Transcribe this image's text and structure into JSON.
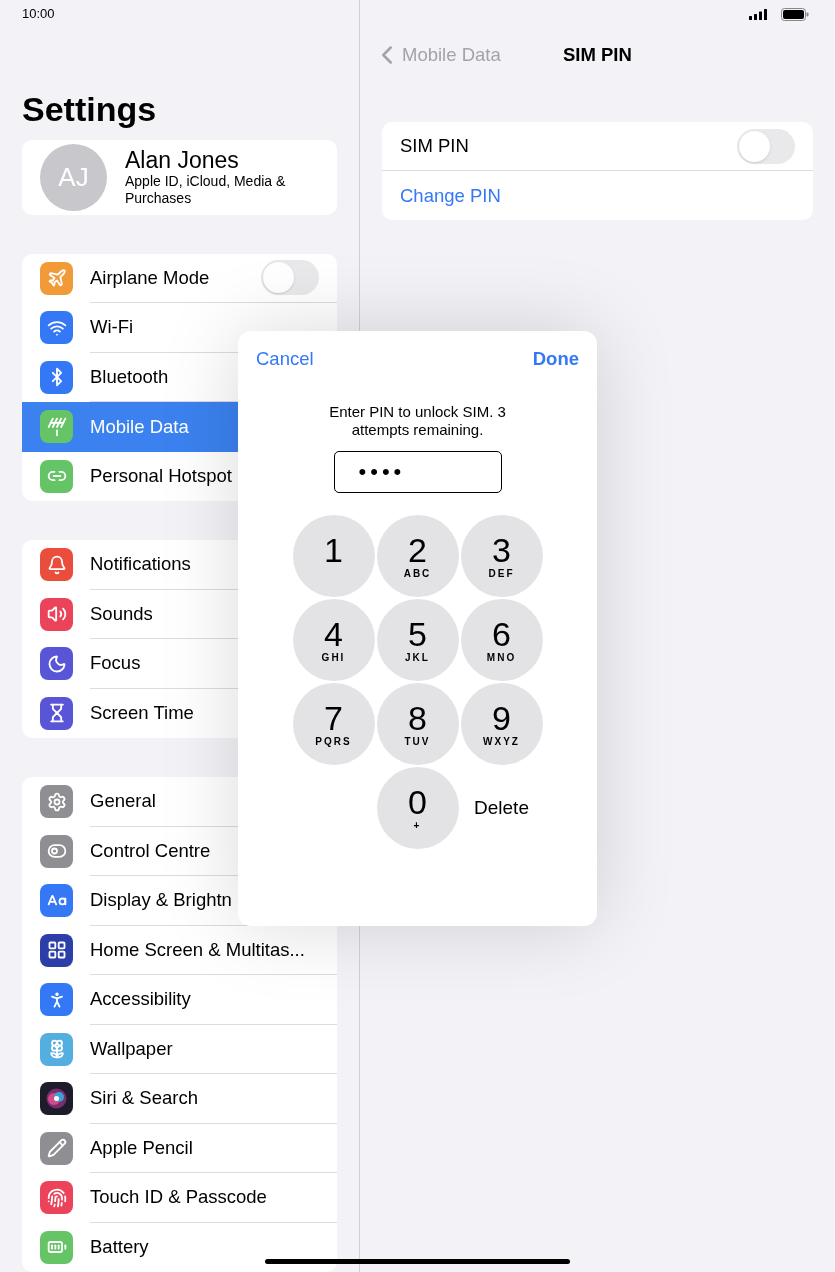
{
  "status_bar": {
    "time": "10:00"
  },
  "sidebar": {
    "title": "Settings",
    "profile": {
      "initials": "AJ",
      "name": "Alan Jones",
      "subtitle": "Apple ID, iCloud, Media & Purchases"
    },
    "groups": [
      [
        {
          "kind": "toggle",
          "color": "#f19a38",
          "label": "Airplane Mode",
          "on": false,
          "selected": false
        },
        {
          "kind": "link",
          "color": "#3478f6",
          "label": "Wi-Fi",
          "selected": false
        },
        {
          "kind": "link",
          "color": "#3478f6",
          "label": "Bluetooth",
          "selected": false
        },
        {
          "kind": "link",
          "color": "#65c466",
          "label": "Mobile Data",
          "selected": true
        },
        {
          "kind": "link",
          "color": "#65c466",
          "label": "Personal Hotspot",
          "selected": false
        }
      ],
      [
        {
          "kind": "link",
          "color": "#eb4d3d",
          "label": "Notifications",
          "selected": false
        },
        {
          "kind": "link",
          "color": "#eb445a",
          "label": "Sounds",
          "selected": false
        },
        {
          "kind": "link",
          "color": "#5856d6",
          "label": "Focus",
          "selected": false
        },
        {
          "kind": "link",
          "color": "#5856d6",
          "label": "Screen Time",
          "selected": false
        }
      ],
      [
        {
          "kind": "link",
          "color": "#8e8e93",
          "label": "General",
          "selected": false
        },
        {
          "kind": "link",
          "color": "#8e8e93",
          "label": "Control Centre",
          "selected": false
        },
        {
          "kind": "link",
          "color": "#3478f6",
          "label": "Display & Brightn",
          "selected": false
        },
        {
          "kind": "link",
          "color": "#2c3ea8",
          "label": "Home Screen & Multitas...",
          "selected": false
        },
        {
          "kind": "link",
          "color": "#3478f6",
          "label": "Accessibility",
          "selected": false
        },
        {
          "kind": "link",
          "color": "#55aee0",
          "label": "Wallpaper",
          "selected": false
        },
        {
          "kind": "link",
          "color": "#1c1c2a",
          "label": "Siri & Search",
          "selected": false
        },
        {
          "kind": "link",
          "color": "#8e8e93",
          "label": "Apple Pencil",
          "selected": false
        },
        {
          "kind": "link",
          "color": "#eb445a",
          "label": "Touch ID & Passcode",
          "selected": false
        },
        {
          "kind": "link",
          "color": "#65c466",
          "label": "Battery",
          "selected": false
        }
      ]
    ]
  },
  "detail": {
    "back": "Mobile Data",
    "title": "SIM PIN",
    "rows": [
      {
        "kind": "toggle",
        "label": "SIM PIN",
        "on": false
      },
      {
        "kind": "link",
        "label": "Change PIN"
      }
    ]
  },
  "dialog": {
    "cancel": "Cancel",
    "done": "Done",
    "message": "Enter PIN to unlock SIM. 3 attempts remaining.",
    "pin": "••••",
    "keys": [
      {
        "kind": "digit",
        "digit": "1"
      },
      {
        "kind": "digit",
        "digit": "2",
        "letters": "ABC"
      },
      {
        "kind": "digit",
        "digit": "3",
        "letters": "DEF"
      },
      {
        "kind": "digit",
        "digit": "4",
        "letters": "GHI"
      },
      {
        "kind": "digit",
        "digit": "5",
        "letters": "JKL"
      },
      {
        "kind": "digit",
        "digit": "6",
        "letters": "MNO"
      },
      {
        "kind": "digit",
        "digit": "7",
        "letters": "PQRS"
      },
      {
        "kind": "digit",
        "digit": "8",
        "letters": "TUV"
      },
      {
        "kind": "digit",
        "digit": "9",
        "letters": "WXYZ"
      },
      {
        "kind": "digit",
        "digit": "0",
        "letters": "+"
      },
      {
        "kind": "delete",
        "label": "Delete"
      }
    ]
  }
}
